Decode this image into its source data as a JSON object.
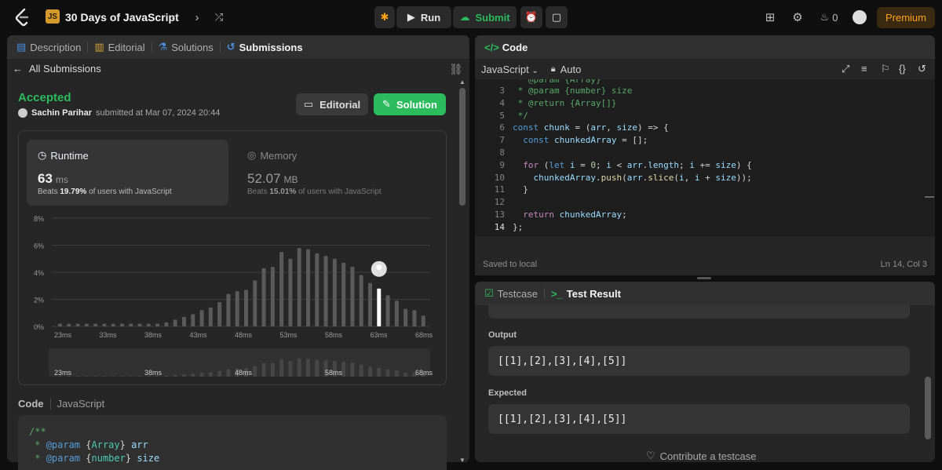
{
  "topbar": {
    "title": "30 Days of JavaScript",
    "problem_icon": "JS",
    "run_label": "Run",
    "submit_label": "Submit",
    "streak_count": "0",
    "premium_label": "Premium"
  },
  "left": {
    "tabs": [
      {
        "label": "Description",
        "icon": "description-icon"
      },
      {
        "label": "Editorial",
        "icon": "book-icon"
      },
      {
        "label": "Solutions",
        "icon": "flask-icon"
      },
      {
        "label": "Submissions",
        "icon": "history-icon"
      }
    ],
    "back_label": "All Submissions",
    "status": "Accepted",
    "author": "Sachin Parihar",
    "submitted_text": "submitted at Mar 07, 2024 20:44",
    "editorial_btn": "Editorial",
    "solution_btn": "Solution",
    "runtime": {
      "title": "Runtime",
      "value": "63",
      "unit": "ms",
      "beats_prefix": "Beats",
      "beats_value": "19.79%",
      "beats_suffix": "of users with JavaScript"
    },
    "memory": {
      "title": "Memory",
      "value": "52.07",
      "unit": "MB",
      "beats_prefix": "Beats",
      "beats_value": "15.01%",
      "beats_suffix": "of users with JavaScript"
    },
    "code_label": "Code",
    "code_lang": "JavaScript",
    "code_lines": [
      "/**",
      " * @param {Array} arr",
      " * @param {number} size"
    ]
  },
  "chart_data": {
    "type": "bar",
    "ylabel": "",
    "y_ticks": [
      "0%",
      "2%",
      "4%",
      "6%",
      "8%"
    ],
    "ylim": [
      0,
      8
    ],
    "x_tick_labels": [
      "23ms",
      "33ms",
      "38ms",
      "43ms",
      "48ms",
      "53ms",
      "58ms",
      "63ms",
      "68ms"
    ],
    "values": [
      0.2,
      0.2,
      0.2,
      0.2,
      0.2,
      0.2,
      0.2,
      0.2,
      0.2,
      0.2,
      0.2,
      0.2,
      0.3,
      0.5,
      0.7,
      0.9,
      1.2,
      1.4,
      1.8,
      2.4,
      2.6,
      2.7,
      3.4,
      4.3,
      4.4,
      5.5,
      5.0,
      5.8,
      5.7,
      5.4,
      5.2,
      5.0,
      4.7,
      4.4,
      3.8,
      3.2,
      2.8,
      2.3,
      1.9,
      1.3,
      1.2,
      0.8
    ],
    "highlight_index": 36,
    "highlight_value": 3.2,
    "grid": true
  },
  "editor": {
    "panel_title": "Code",
    "language": "JavaScript",
    "mode": "Auto",
    "lines": [
      {
        "n": "3",
        "segs": [
          [
            " * ",
            "c-com"
          ],
          [
            "@param",
            "c-com"
          ],
          [
            " {number} ",
            "c-com"
          ],
          [
            "size",
            "c-com"
          ]
        ]
      },
      {
        "n": "4",
        "segs": [
          [
            " * @return {Array[]}",
            "c-com"
          ]
        ]
      },
      {
        "n": "5",
        "segs": [
          [
            " */",
            "c-com"
          ]
        ]
      },
      {
        "n": "6",
        "segs": [
          [
            "const ",
            "c-kw"
          ],
          [
            "chunk",
            "c-var"
          ],
          [
            " = (",
            "c-plain"
          ],
          [
            "arr",
            "c-var"
          ],
          [
            ", ",
            "c-plain"
          ],
          [
            "size",
            "c-var"
          ],
          [
            ") => {",
            "c-plain"
          ]
        ]
      },
      {
        "n": "7",
        "segs": [
          [
            "  const ",
            "c-kw"
          ],
          [
            "chunkedArray",
            "c-var"
          ],
          [
            " = [];",
            "c-plain"
          ]
        ]
      },
      {
        "n": "8",
        "segs": [
          [
            "",
            "c-plain"
          ]
        ]
      },
      {
        "n": "9",
        "segs": [
          [
            "  for",
            "c-ctrl"
          ],
          [
            " (",
            "c-plain"
          ],
          [
            "let ",
            "c-kw"
          ],
          [
            "i",
            "c-var"
          ],
          [
            " = ",
            "c-plain"
          ],
          [
            "0",
            "c-num"
          ],
          [
            "; ",
            "c-plain"
          ],
          [
            "i",
            "c-var"
          ],
          [
            " < ",
            "c-plain"
          ],
          [
            "arr",
            "c-var"
          ],
          [
            ".",
            "c-plain"
          ],
          [
            "length",
            "c-var"
          ],
          [
            "; ",
            "c-plain"
          ],
          [
            "i",
            "c-var"
          ],
          [
            " += ",
            "c-plain"
          ],
          [
            "size",
            "c-var"
          ],
          [
            ") {",
            "c-plain"
          ]
        ]
      },
      {
        "n": "10",
        "segs": [
          [
            "    chunkedArray",
            "c-var"
          ],
          [
            ".",
            "c-plain"
          ],
          [
            "push",
            "c-fn"
          ],
          [
            "(",
            "c-plain"
          ],
          [
            "arr",
            "c-var"
          ],
          [
            ".",
            "c-plain"
          ],
          [
            "slice",
            "c-fn"
          ],
          [
            "(",
            "c-plain"
          ],
          [
            "i",
            "c-var"
          ],
          [
            ", ",
            "c-plain"
          ],
          [
            "i",
            "c-var"
          ],
          [
            " + ",
            "c-plain"
          ],
          [
            "size",
            "c-var"
          ],
          [
            "));",
            "c-plain"
          ]
        ]
      },
      {
        "n": "11",
        "segs": [
          [
            "  }",
            "c-plain"
          ]
        ]
      },
      {
        "n": "12",
        "segs": [
          [
            "",
            "c-plain"
          ]
        ]
      },
      {
        "n": "13",
        "segs": [
          [
            "  return ",
            "c-ctrl"
          ],
          [
            "chunkedArray",
            "c-var"
          ],
          [
            ";",
            "c-plain"
          ]
        ]
      },
      {
        "n": "14",
        "segs": [
          [
            "};",
            "c-plain"
          ]
        ]
      }
    ],
    "saved_text": "Saved to local",
    "cursor_pos": "Ln 14, Col 3"
  },
  "results": {
    "tab_testcase": "Testcase",
    "tab_result": "Test Result",
    "output_label": "Output",
    "output_value": "[[1],[2],[3],[4],[5]]",
    "expected_label": "Expected",
    "expected_value": "[[1],[2],[3],[4],[5]]",
    "contribute_label": "Contribute a testcase"
  }
}
